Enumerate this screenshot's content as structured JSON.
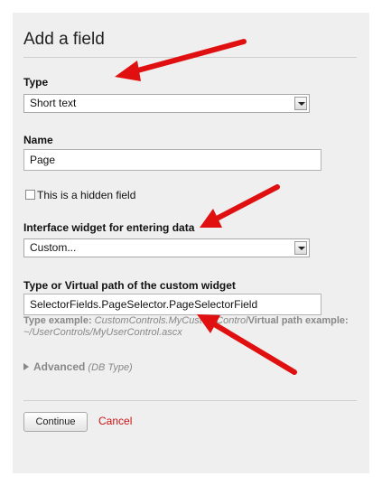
{
  "form": {
    "title": "Add a field",
    "type_label": "Type",
    "type_value": "Short text",
    "name_label": "Name",
    "name_value": "Page",
    "hidden_label": "This is a hidden field",
    "widget_label": "Interface widget for entering data",
    "widget_value": "Custom...",
    "virtual_path_label": "Type or Virtual path of the custom widget",
    "virtual_path_value": "SelectorFields.PageSelector.PageSelectorField",
    "hint_type_heading": "Type example:",
    "hint_type_example": "CustomControls.MyCustomControl",
    "hint_path_heading": "Virtual path example:",
    "hint_path_example": "~/UserControls/MyUserControl.ascx",
    "advanced_label": "Advanced",
    "advanced_note": "(DB Type)",
    "continue_label": "Continue",
    "cancel_label": "Cancel"
  },
  "colors": {
    "panel_bg": "#efefef",
    "cancel_link": "#cc1111",
    "annotation_arrow": "#e01010"
  },
  "icons": [
    "dropdown-arrow-icon",
    "expand-triangle-icon",
    "annotation-arrow"
  ]
}
